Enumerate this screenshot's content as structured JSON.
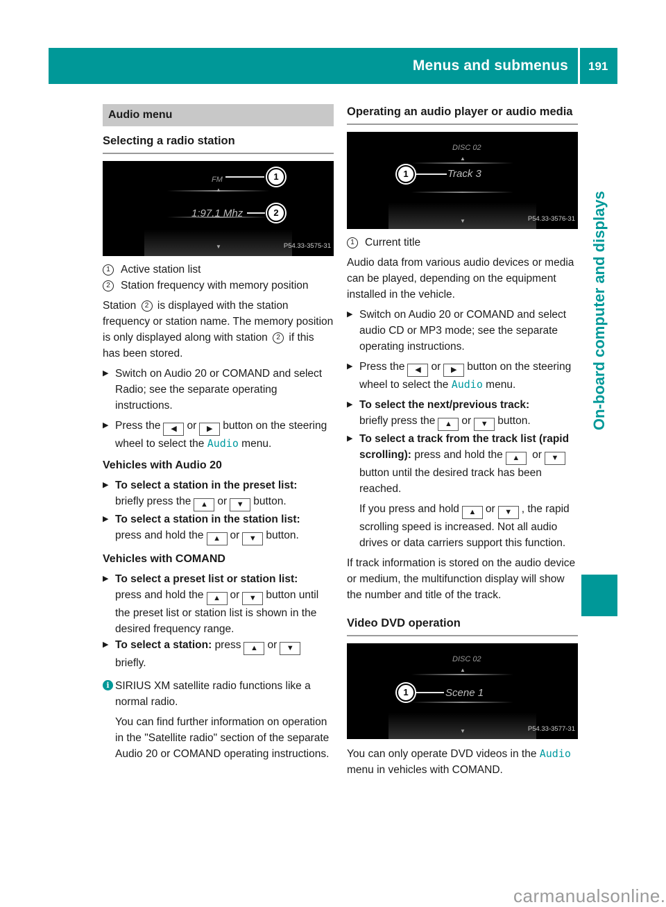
{
  "header": {
    "title": "Menus and submenus",
    "page_number": "191",
    "side_tab": "On-board computer and displays",
    "accent_color": "#009898"
  },
  "left": {
    "band": "Audio menu",
    "heading": "Selecting a radio station",
    "figure": {
      "top_label": "FM",
      "center_label": "1:97.1 Mhz",
      "code": "P54.33-3575-31",
      "callouts": [
        "1",
        "2"
      ]
    },
    "legend": [
      {
        "num": "1",
        "text": "Active station list"
      },
      {
        "num": "2",
        "text": "Station frequency with memory position"
      }
    ],
    "para1_a": "Station ",
    "para1_b": " is displayed with the station frequency or station name. The memory position is only displayed along with station ",
    "para1_c": " if this has been stored.",
    "para1_ref": "2",
    "step1": "Switch on Audio 20 or COMAND and select Radio; see the separate operating instructions.",
    "step2_a": "Press the",
    "step2_or": "or",
    "step2_b": "button on the steering wheel to select the",
    "step2_menu": "Audio",
    "step2_c": "menu.",
    "sub1": "Vehicles with Audio 20",
    "s1_bold": "To select a station in the preset list:",
    "s1_a": "briefly press the",
    "s1_or": "or",
    "s1_b": "button.",
    "s2_bold": "To select a station in the station list:",
    "s2_a": "press and hold the",
    "s2_or": "or",
    "s2_b": "button.",
    "sub2": "Vehicles with COMAND",
    "s3_bold": "To select a preset list or station list:",
    "s3_a": "press and hold the",
    "s3_or": "or",
    "s3_b": "button until the preset list or station list is shown in the desired frequency range.",
    "s4_bold": "To select a station:",
    "s4_a": "press",
    "s4_or": "or",
    "s4_b": "briefly.",
    "info1": "SIRIUS XM satellite radio functions like a normal radio.",
    "info2": "You can find further information on operation in the \"Satellite radio\" section of the separate Audio 20 or COMAND operating instructions."
  },
  "right": {
    "heading": "Operating an audio player or audio media",
    "figure": {
      "top_label": "DISC 02",
      "center_label": "Track 3",
      "code": "P54.33-3576-31",
      "callouts": [
        "1"
      ]
    },
    "legend": [
      {
        "num": "1",
        "text": "Current title"
      }
    ],
    "para1": "Audio data from various audio devices or media can be played, depending on the equipment installed in the vehicle.",
    "step1": "Switch on Audio 20 or COMAND and select audio CD or MP3 mode; see the separate operating instructions.",
    "step2_a": "Press the",
    "step2_or": "or",
    "step2_b": "button on the steering wheel to select the",
    "step2_menu": "Audio",
    "step2_c": "menu.",
    "s1_bold": "To select the next/previous track:",
    "s1_a": "briefly press the",
    "s1_or": "or",
    "s1_b": "button.",
    "s2_bold": "To select a track from the track list (rapid scrolling):",
    "s2_a": "press and hold the",
    "s2_or": "or",
    "s2_b": "button until the desired track has been reached.",
    "s2_note_a": "If you press and hold",
    "s2_note_or": "or",
    "s2_note_b": ", the rapid scrolling speed is increased. Not all audio drives or data carriers support this function.",
    "para2": "If track information is stored on the audio device or medium, the multifunction display will show the number and title of the track.",
    "heading2": "Video DVD operation",
    "figure2": {
      "top_label": "DISC 02",
      "center_label": "Scene 1",
      "code": "P54.33-3577-31",
      "callouts": [
        "1"
      ]
    },
    "para3_a": "You can only operate DVD videos in the",
    "para3_menu": "Audio",
    "para3_b": "menu in vehicles with COMAND."
  },
  "icons": {
    "left": "◀",
    "right": "▶",
    "up": "▲",
    "down": "▼",
    "info": "i"
  },
  "watermark": "carmanualsonline.info"
}
